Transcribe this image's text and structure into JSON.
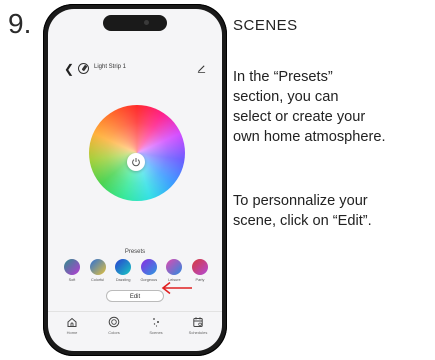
{
  "step_number": "9.",
  "app": {
    "device_title": "Light Strip 1",
    "presets_label": "Presets",
    "presets": [
      {
        "name": "Soft",
        "color_a": "#2e8f8a",
        "color_b": "#b83ad6"
      },
      {
        "name": "Colorful",
        "color_a": "#2b6fd6",
        "color_b": "#e6c23a"
      },
      {
        "name": "Dazzling",
        "color_a": "#2a3fd0",
        "color_b": "#18c9c2"
      },
      {
        "name": "Gorgeous",
        "color_a": "#8a2be2",
        "color_b": "#2a9be0"
      },
      {
        "name": "Leisure",
        "color_a": "#e04ab0",
        "color_b": "#2a8be0"
      },
      {
        "name": "Party",
        "color_a": "#d73a3a",
        "color_b": "#b24ad8"
      }
    ],
    "edit_label": "Edit",
    "nav": [
      {
        "label": "Home",
        "icon": "home-icon"
      },
      {
        "label": "Colors",
        "icon": "palette-icon"
      },
      {
        "label": "Scenes",
        "icon": "sparkle-icon"
      },
      {
        "label": "Schedules",
        "icon": "calendar-icon"
      }
    ]
  },
  "instructions": {
    "title": "SCENES",
    "paragraph1": [
      "In the “Presets”",
      "section, you can",
      "select or create your",
      "own home atmosphere."
    ],
    "paragraph2": [
      "To personnalize your",
      "scene, click on “Edit”."
    ]
  },
  "colors": {
    "arrow": "#e02020",
    "phone_frame": "#1a1a1a"
  }
}
